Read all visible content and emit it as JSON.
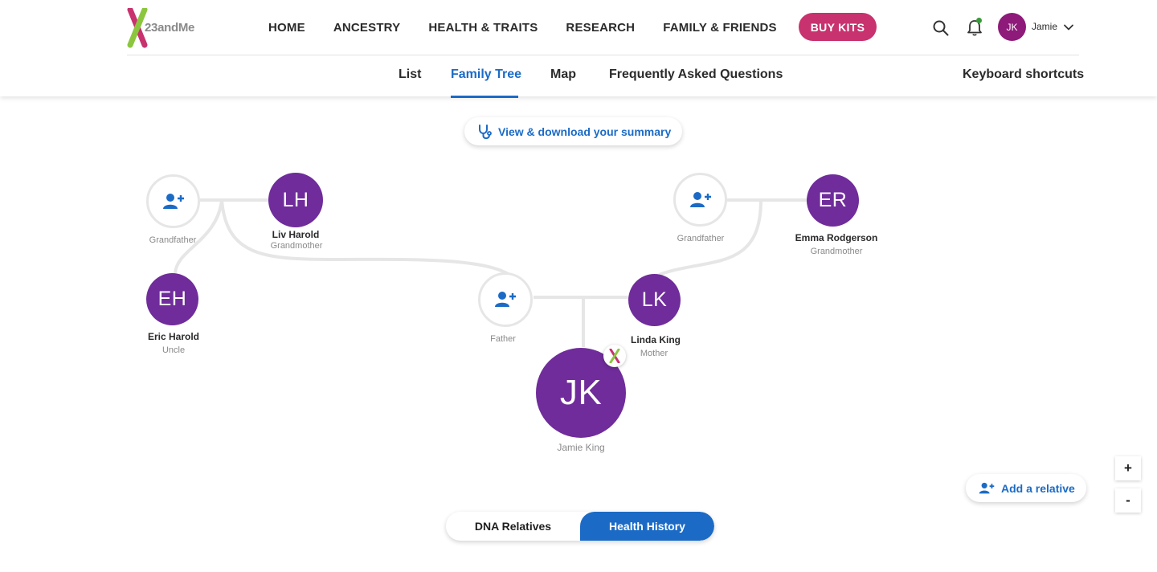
{
  "brand": {
    "logo_text": "23andMe",
    "accent": "#c8326e",
    "link_blue": "#1b6bc6",
    "node_purple": "#6f2c9a"
  },
  "nav": {
    "items": [
      {
        "label": "HOME"
      },
      {
        "label": "ANCESTRY"
      },
      {
        "label": "HEALTH & TRAITS"
      },
      {
        "label": "RESEARCH"
      },
      {
        "label": "FAMILY & FRIENDS"
      }
    ],
    "buy_label": "BUY KITS"
  },
  "user": {
    "initials": "JK",
    "name": "Jamie"
  },
  "subnav": {
    "items": [
      {
        "label": "List"
      },
      {
        "label": "Family Tree"
      },
      {
        "label": "Map"
      },
      {
        "label": "Frequently Asked Questions"
      }
    ],
    "active": "Family Tree",
    "keyboard_label": "Keyboard shortcuts"
  },
  "summary_button": {
    "label": "View & download your summary"
  },
  "tree": {
    "paternal_grandfather": {
      "relation": "Grandfather"
    },
    "paternal_grandmother": {
      "initials": "LH",
      "name": "Liv Harold",
      "relation": "Grandmother"
    },
    "uncle": {
      "initials": "EH",
      "name": "Eric Harold",
      "relation": "Uncle"
    },
    "maternal_grandfather": {
      "relation": "Grandfather"
    },
    "maternal_grandmother": {
      "initials": "ER",
      "name": "Emma Rodgerson",
      "relation": "Grandmother"
    },
    "father": {
      "relation": "Father"
    },
    "mother": {
      "initials": "LK",
      "name": "Linda King",
      "relation": "Mother"
    },
    "self": {
      "initials": "JK",
      "name": "Jamie King"
    }
  },
  "add_relative": {
    "label": "Add a relative"
  },
  "zoom": {
    "in_label": "+",
    "out_label": "-"
  },
  "toggle": {
    "options": [
      {
        "label": "DNA Relatives"
      },
      {
        "label": "Health History"
      }
    ],
    "active": "Health History"
  }
}
